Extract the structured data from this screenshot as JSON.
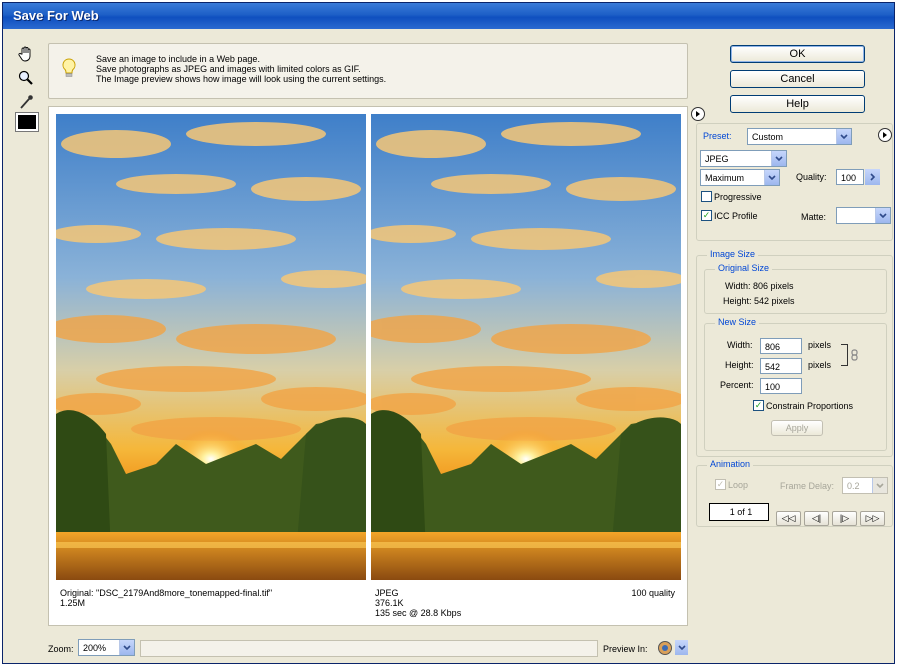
{
  "window": {
    "title": "Save For Web"
  },
  "toolbox": {
    "tools": [
      "hand-icon",
      "zoom-icon",
      "eyedropper-icon"
    ],
    "swatch_color": "#000000"
  },
  "info": {
    "lines": [
      "Save an image to include in a Web page.",
      "Save photographs as JPEG and images with limited colors as GIF.",
      "The Image preview shows how image will look using the current settings."
    ]
  },
  "preview": {
    "original": {
      "line1": "Original: \"DSC_2179And8more_tonemapped-final.tif\"",
      "line2": "1.25M"
    },
    "optimized": {
      "line1": "JPEG",
      "line2": "376.1K",
      "line3": "135 sec @ 28.8 Kbps",
      "quality": "100 quality"
    }
  },
  "buttons": {
    "ok": "OK",
    "cancel": "Cancel",
    "help": "Help"
  },
  "settings": {
    "preset_label": "Preset:",
    "preset_value": "Custom",
    "format_value": "JPEG",
    "compression_value": "Maximum",
    "quality_label": "Quality:",
    "quality_value": "100",
    "progressive_label": "Progressive",
    "progressive_checked": false,
    "icc_label": "ICC Profile",
    "icc_checked": true,
    "matte_label": "Matte:"
  },
  "image_size": {
    "title": "Image Size",
    "original_title": "Original Size",
    "orig_width": "Width:  806 pixels",
    "orig_height": "Height:  542 pixels",
    "new_title": "New Size",
    "width_label": "Width:",
    "width_value": "806",
    "height_label": "Height:",
    "height_value": "542",
    "pixels1": "pixels",
    "pixels2": "pixels",
    "percent_label": "Percent:",
    "percent_value": "100",
    "constrain_label": "Constrain Proportions",
    "constrain_checked": true,
    "apply": "Apply"
  },
  "animation": {
    "title": "Animation",
    "loop_label": "Loop",
    "frame_delay_label": "Frame Delay:",
    "frame_delay_value": "0.2",
    "frame_counter": "1 of 1"
  },
  "bottom": {
    "zoom_label": "Zoom:",
    "zoom_value": "200%",
    "preview_in_label": "Preview In:"
  }
}
